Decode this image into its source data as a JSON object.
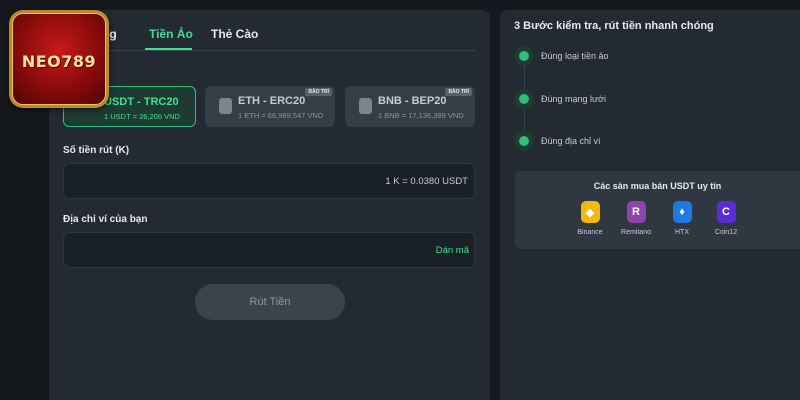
{
  "logo": {
    "text": "NEO789"
  },
  "tabs": [
    {
      "label": "ng"
    },
    {
      "label": "Tiền Ảo"
    },
    {
      "label": "Thẻ Cào"
    }
  ],
  "coins": [
    {
      "name": "USDT - TRC20",
      "rate": "1 USDT = 26,206 VND",
      "badge": ""
    },
    {
      "name": "ETH - ERC20",
      "rate": "1 ETH = 66,989,547 VND",
      "badge": "BẢO TRÌ"
    },
    {
      "name": "BNB - BEP20",
      "rate": "1 BNB = 17,136,399 VND",
      "badge": "BẢO TRÌ"
    }
  ],
  "amount": {
    "label": "Số tiền rút (K)",
    "value": "1 K = 0.0380 USDT"
  },
  "wallet": {
    "label": "Địa chỉ ví của bạn",
    "paste_label": "Dán mã"
  },
  "withdraw_label": "Rút Tiền",
  "guide": {
    "title": "3 Bước kiểm tra, rút tiền nhanh chóng",
    "steps": [
      {
        "text": "Đúng loại tiền ảo",
        "icon": "coin-icon"
      },
      {
        "text": "Đúng mạng lưới",
        "icon": "network-icon"
      },
      {
        "text": "Đúng địa chỉ ví",
        "icon": "wallet-icon"
      }
    ]
  },
  "exchanges": {
    "title": "Các sàn mua bán USDT uy tín",
    "items": [
      {
        "name": "Binance",
        "glyph": "◆",
        "color": "#f0b90b"
      },
      {
        "name": "Remitano",
        "glyph": "R",
        "color": "#8e44ad"
      },
      {
        "name": "HTX",
        "glyph": "♦",
        "color": "#1f7ae0"
      },
      {
        "name": "Coin12",
        "glyph": "C",
        "color": "#5b2bd6"
      }
    ]
  },
  "colors": {
    "accent": "#3ee08f",
    "panel": "#232a32",
    "background": "#15191e"
  }
}
